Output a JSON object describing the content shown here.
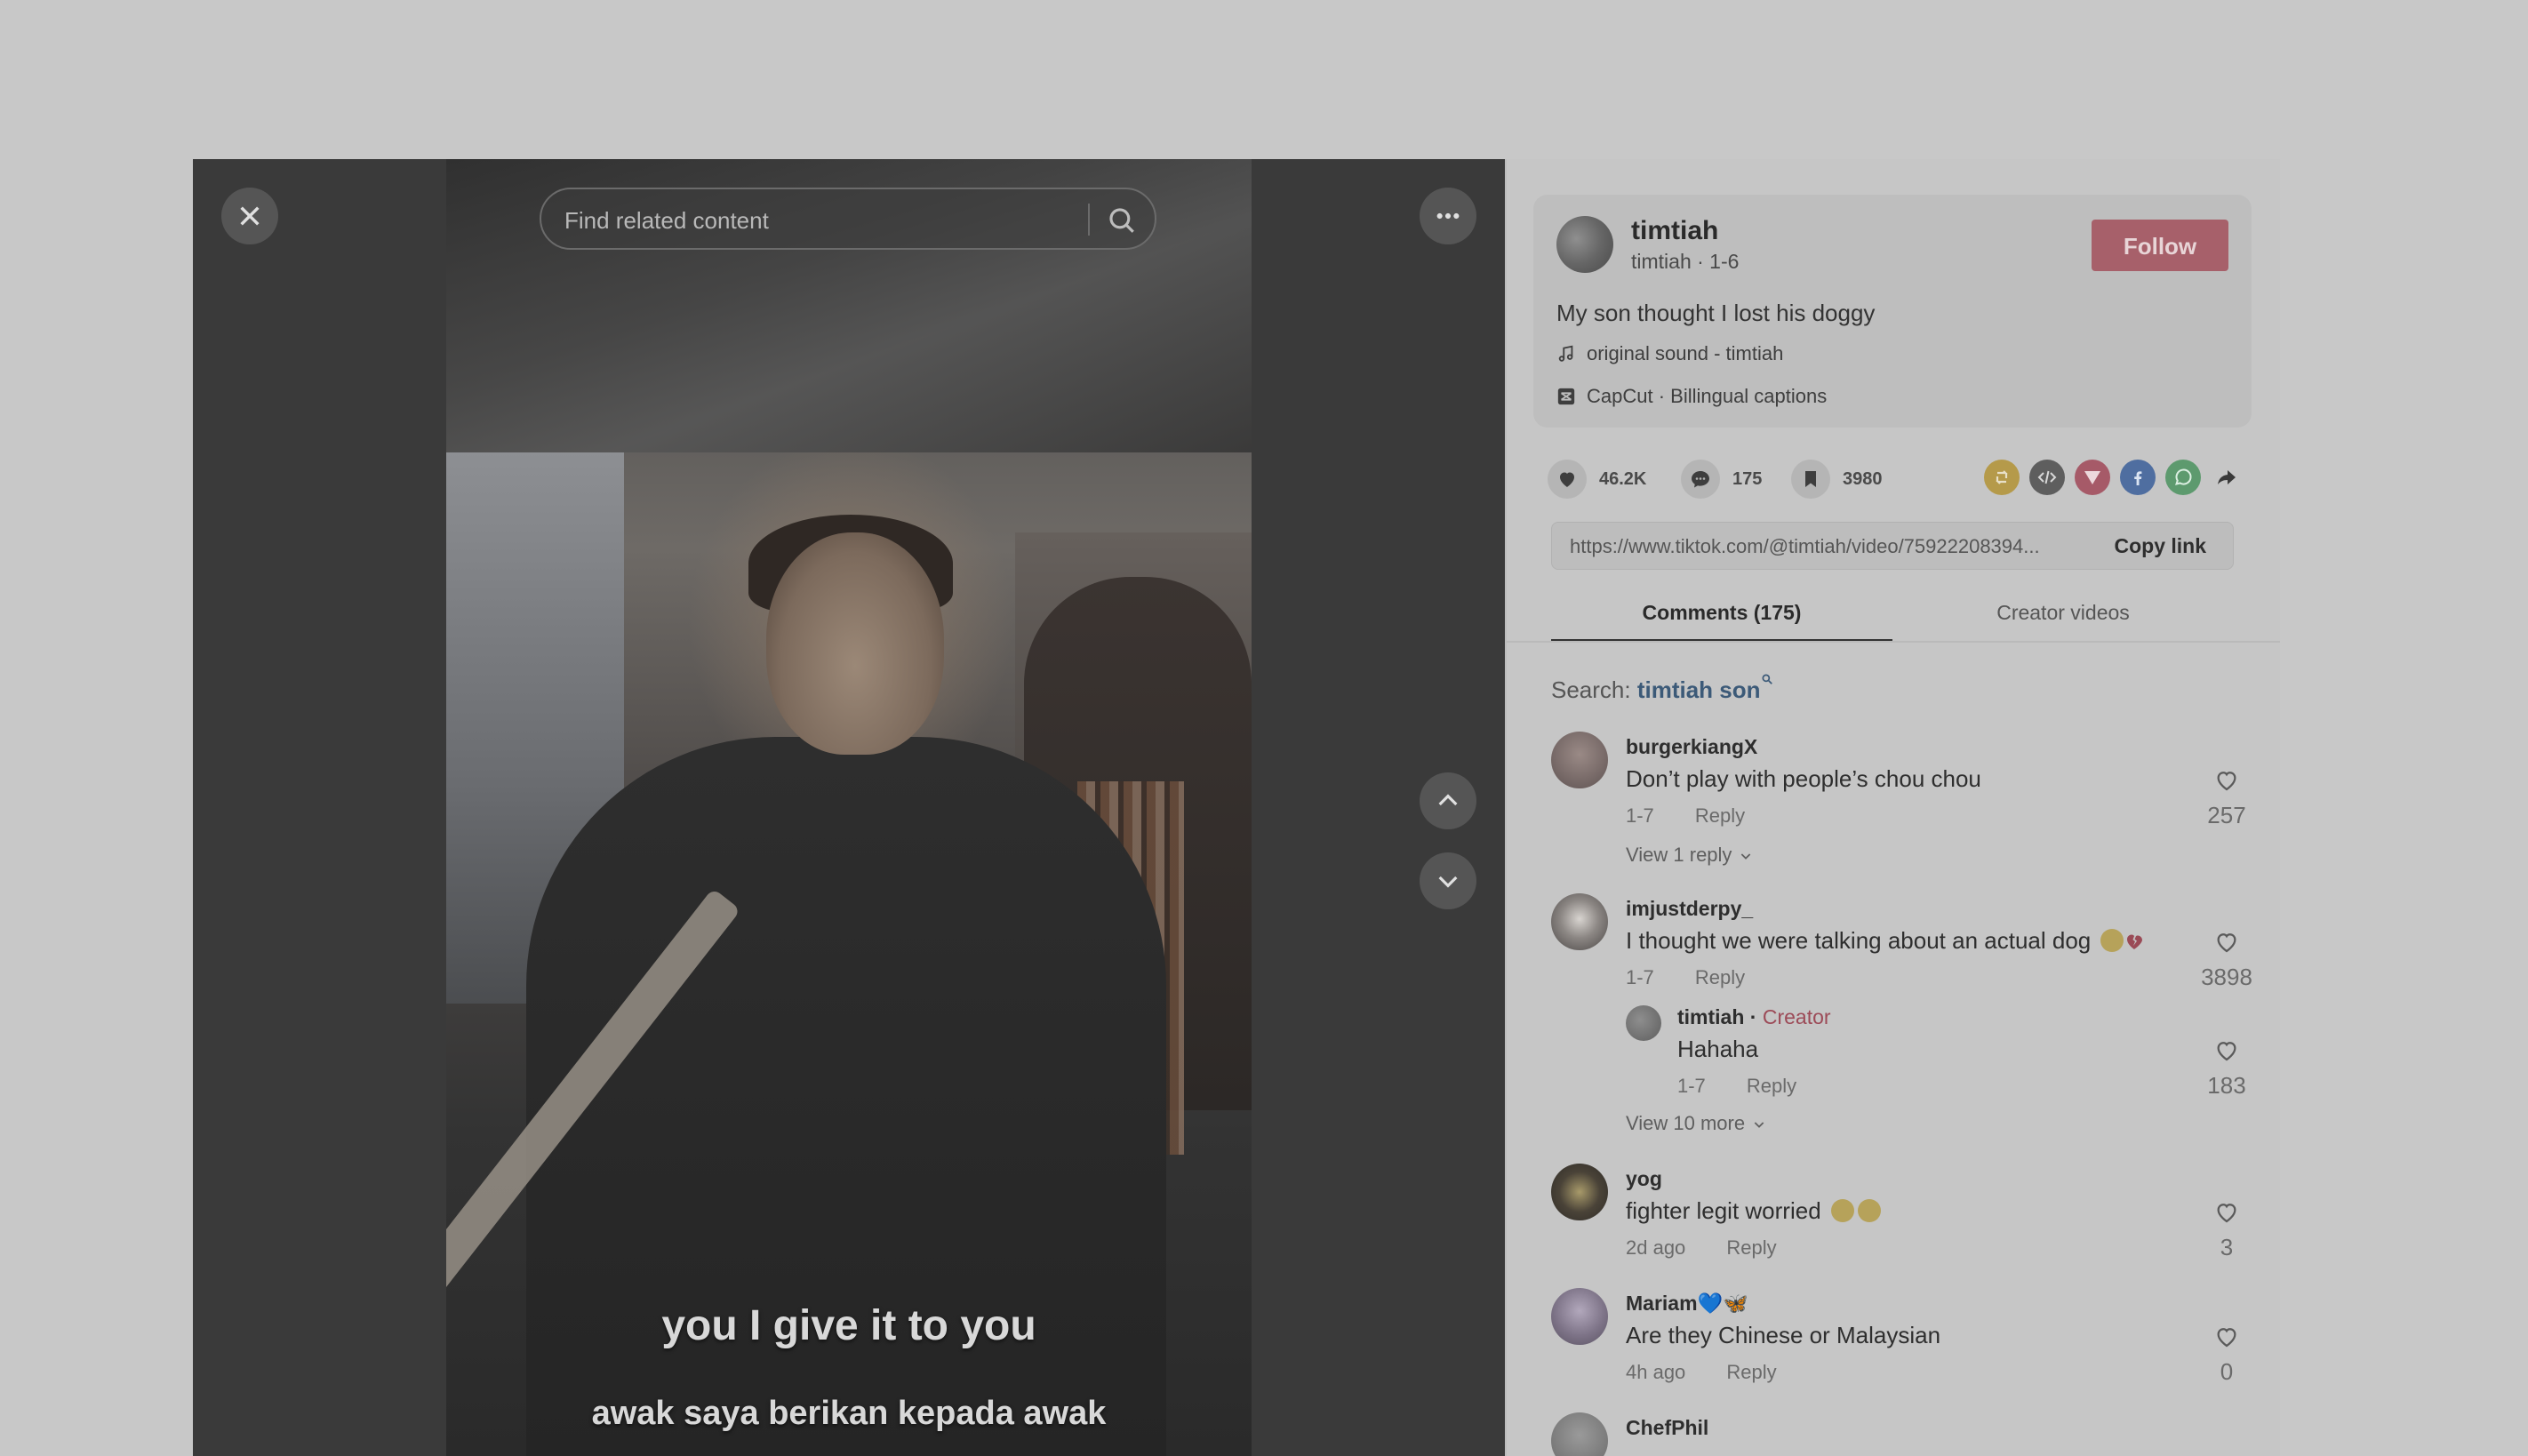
{
  "search": {
    "placeholder": "Find related content"
  },
  "video": {
    "caption_en": "you I give it to you",
    "caption_ms": "awak saya berikan kepada awak"
  },
  "creator": {
    "name": "timtiah",
    "handle_line": "timtiah · 1-6",
    "follow_label": "Follow",
    "description": "My son thought I lost his doggy",
    "sound": "original sound - timtiah",
    "capcut": "CapCut · Billingual captions"
  },
  "stats": {
    "likes": "46.2K",
    "comments": "175",
    "saves": "3980"
  },
  "share": {
    "url": "https://www.tiktok.com/@timtiah/video/75922208394...",
    "copy_label": "Copy link"
  },
  "tabs": {
    "comments": "Comments (175)",
    "videos": "Creator videos"
  },
  "search_suggest": {
    "label": "Search:",
    "term": "timtiah son"
  },
  "comments": [
    {
      "user": "burgerkiangX",
      "text": "Don’t play with people’s chou chou",
      "date": "1-7",
      "reply": "Reply",
      "likes": "257",
      "view_more": "View 1 reply"
    },
    {
      "user": "imjustderpy_",
      "text": "I thought we were talking about an actual dog",
      "date": "1-7",
      "reply": "Reply",
      "likes": "3898",
      "sub": {
        "user": "timtiah",
        "creator_tag": "Creator",
        "text": "Hahaha",
        "date": "1-7",
        "reply": "Reply",
        "likes": "183"
      },
      "view_more": "View 10 more"
    },
    {
      "user": "yog",
      "text": "fighter legit worried",
      "date": "2d ago",
      "reply": "Reply",
      "likes": "3"
    },
    {
      "user": "Mariam💙🦋",
      "text": "Are they Chinese or Malaysian",
      "date": "4h ago",
      "reply": "Reply",
      "likes": "0"
    },
    {
      "user": "ChefPhil"
    }
  ],
  "colors": {
    "follow": "#a7606a",
    "creator_tag": "#9c4a57",
    "search_term": "#3c5a78"
  }
}
